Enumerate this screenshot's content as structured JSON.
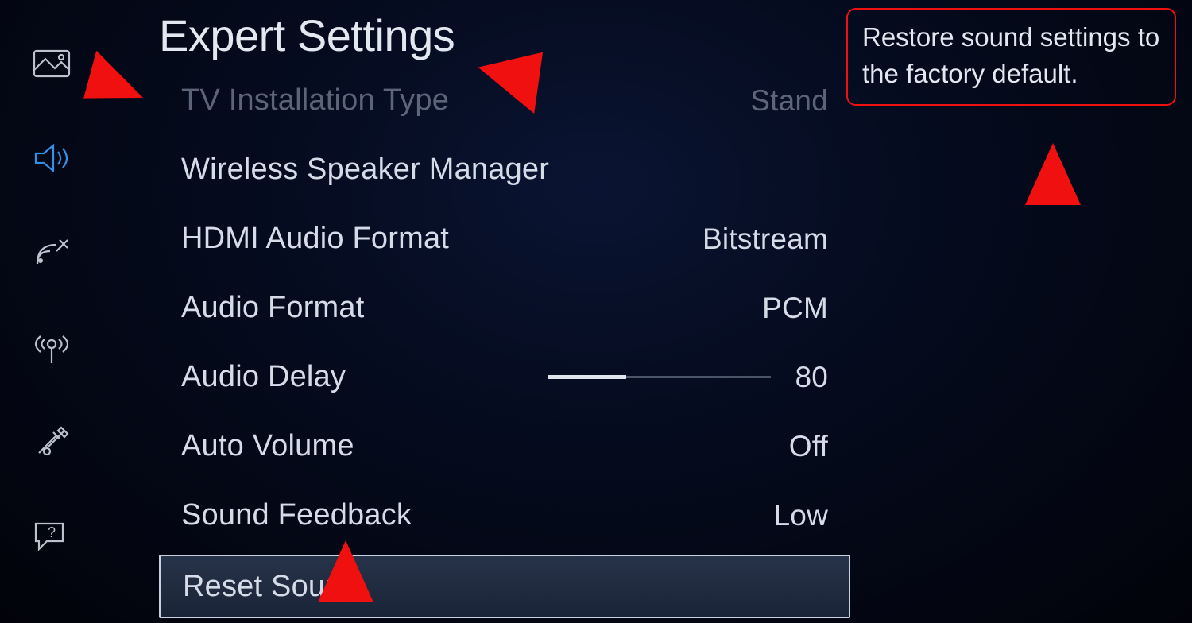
{
  "title": "Expert Settings",
  "sidebar": {
    "items": [
      {
        "icon": "picture-icon"
      },
      {
        "icon": "sound-icon",
        "active": true
      },
      {
        "icon": "broadcast-icon"
      },
      {
        "icon": "network-icon"
      },
      {
        "icon": "tools-icon"
      },
      {
        "icon": "support-icon"
      }
    ]
  },
  "menu": {
    "items": [
      {
        "label": "TV Installation Type",
        "value": "Stand",
        "dim": true
      },
      {
        "label": "Wireless Speaker Manager",
        "value": ""
      },
      {
        "label": "HDMI Audio Format",
        "value": "Bitstream"
      },
      {
        "label": "Audio Format",
        "value": "PCM"
      },
      {
        "label": "Audio Delay",
        "value": "80",
        "slider": true,
        "slider_percent": 35
      },
      {
        "label": "Auto Volume",
        "value": "Off"
      },
      {
        "label": "Sound Feedback",
        "value": "Low"
      },
      {
        "label": "Reset Sound",
        "value": "",
        "selected": true
      }
    ]
  },
  "tooltip": "Restore sound settings to the factory default.",
  "colors": {
    "accent": "#3aa0ff",
    "annotation": "#f01010"
  }
}
